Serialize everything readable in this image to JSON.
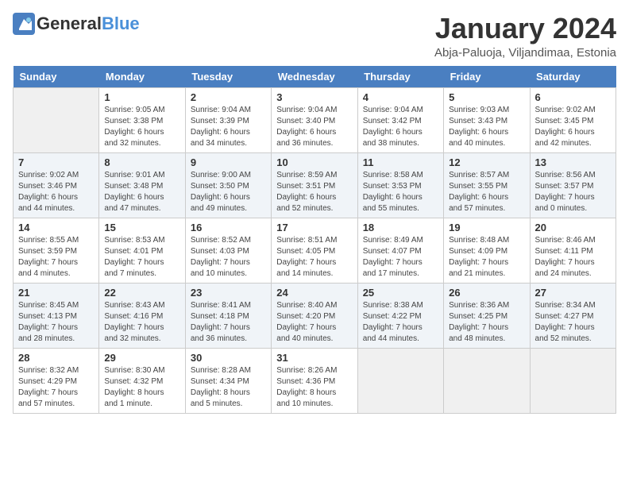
{
  "header": {
    "logo_general": "General",
    "logo_blue": "Blue",
    "title": "January 2024",
    "subtitle": "Abja-Paluoja, Viljandimaa, Estonia"
  },
  "days": [
    "Sunday",
    "Monday",
    "Tuesday",
    "Wednesday",
    "Thursday",
    "Friday",
    "Saturday"
  ],
  "weeks": [
    [
      {
        "date": "",
        "info": ""
      },
      {
        "date": "1",
        "info": "Sunrise: 9:05 AM\nSunset: 3:38 PM\nDaylight: 6 hours\nand 32 minutes."
      },
      {
        "date": "2",
        "info": "Sunrise: 9:04 AM\nSunset: 3:39 PM\nDaylight: 6 hours\nand 34 minutes."
      },
      {
        "date": "3",
        "info": "Sunrise: 9:04 AM\nSunset: 3:40 PM\nDaylight: 6 hours\nand 36 minutes."
      },
      {
        "date": "4",
        "info": "Sunrise: 9:04 AM\nSunset: 3:42 PM\nDaylight: 6 hours\nand 38 minutes."
      },
      {
        "date": "5",
        "info": "Sunrise: 9:03 AM\nSunset: 3:43 PM\nDaylight: 6 hours\nand 40 minutes."
      },
      {
        "date": "6",
        "info": "Sunrise: 9:02 AM\nSunset: 3:45 PM\nDaylight: 6 hours\nand 42 minutes."
      }
    ],
    [
      {
        "date": "7",
        "info": "Sunrise: 9:02 AM\nSunset: 3:46 PM\nDaylight: 6 hours\nand 44 minutes."
      },
      {
        "date": "8",
        "info": "Sunrise: 9:01 AM\nSunset: 3:48 PM\nDaylight: 6 hours\nand 47 minutes."
      },
      {
        "date": "9",
        "info": "Sunrise: 9:00 AM\nSunset: 3:50 PM\nDaylight: 6 hours\nand 49 minutes."
      },
      {
        "date": "10",
        "info": "Sunrise: 8:59 AM\nSunset: 3:51 PM\nDaylight: 6 hours\nand 52 minutes."
      },
      {
        "date": "11",
        "info": "Sunrise: 8:58 AM\nSunset: 3:53 PM\nDaylight: 6 hours\nand 55 minutes."
      },
      {
        "date": "12",
        "info": "Sunrise: 8:57 AM\nSunset: 3:55 PM\nDaylight: 6 hours\nand 57 minutes."
      },
      {
        "date": "13",
        "info": "Sunrise: 8:56 AM\nSunset: 3:57 PM\nDaylight: 7 hours\nand 0 minutes."
      }
    ],
    [
      {
        "date": "14",
        "info": "Sunrise: 8:55 AM\nSunset: 3:59 PM\nDaylight: 7 hours\nand 4 minutes."
      },
      {
        "date": "15",
        "info": "Sunrise: 8:53 AM\nSunset: 4:01 PM\nDaylight: 7 hours\nand 7 minutes."
      },
      {
        "date": "16",
        "info": "Sunrise: 8:52 AM\nSunset: 4:03 PM\nDaylight: 7 hours\nand 10 minutes."
      },
      {
        "date": "17",
        "info": "Sunrise: 8:51 AM\nSunset: 4:05 PM\nDaylight: 7 hours\nand 14 minutes."
      },
      {
        "date": "18",
        "info": "Sunrise: 8:49 AM\nSunset: 4:07 PM\nDaylight: 7 hours\nand 17 minutes."
      },
      {
        "date": "19",
        "info": "Sunrise: 8:48 AM\nSunset: 4:09 PM\nDaylight: 7 hours\nand 21 minutes."
      },
      {
        "date": "20",
        "info": "Sunrise: 8:46 AM\nSunset: 4:11 PM\nDaylight: 7 hours\nand 24 minutes."
      }
    ],
    [
      {
        "date": "21",
        "info": "Sunrise: 8:45 AM\nSunset: 4:13 PM\nDaylight: 7 hours\nand 28 minutes."
      },
      {
        "date": "22",
        "info": "Sunrise: 8:43 AM\nSunset: 4:16 PM\nDaylight: 7 hours\nand 32 minutes."
      },
      {
        "date": "23",
        "info": "Sunrise: 8:41 AM\nSunset: 4:18 PM\nDaylight: 7 hours\nand 36 minutes."
      },
      {
        "date": "24",
        "info": "Sunrise: 8:40 AM\nSunset: 4:20 PM\nDaylight: 7 hours\nand 40 minutes."
      },
      {
        "date": "25",
        "info": "Sunrise: 8:38 AM\nSunset: 4:22 PM\nDaylight: 7 hours\nand 44 minutes."
      },
      {
        "date": "26",
        "info": "Sunrise: 8:36 AM\nSunset: 4:25 PM\nDaylight: 7 hours\nand 48 minutes."
      },
      {
        "date": "27",
        "info": "Sunrise: 8:34 AM\nSunset: 4:27 PM\nDaylight: 7 hours\nand 52 minutes."
      }
    ],
    [
      {
        "date": "28",
        "info": "Sunrise: 8:32 AM\nSunset: 4:29 PM\nDaylight: 7 hours\nand 57 minutes."
      },
      {
        "date": "29",
        "info": "Sunrise: 8:30 AM\nSunset: 4:32 PM\nDaylight: 8 hours\nand 1 minute."
      },
      {
        "date": "30",
        "info": "Sunrise: 8:28 AM\nSunset: 4:34 PM\nDaylight: 8 hours\nand 5 minutes."
      },
      {
        "date": "31",
        "info": "Sunrise: 8:26 AM\nSunset: 4:36 PM\nDaylight: 8 hours\nand 10 minutes."
      },
      {
        "date": "",
        "info": ""
      },
      {
        "date": "",
        "info": ""
      },
      {
        "date": "",
        "info": ""
      }
    ]
  ]
}
